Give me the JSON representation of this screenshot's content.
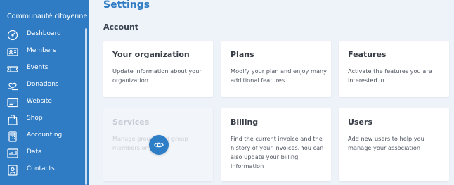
{
  "sidebar": {
    "org_name": "Communauté citoyenne",
    "items": [
      {
        "label": "Dashboard",
        "icon": "dashboard-icon"
      },
      {
        "label": "Members",
        "icon": "members-icon"
      },
      {
        "label": "Events",
        "icon": "events-icon"
      },
      {
        "label": "Donations",
        "icon": "donations-icon"
      },
      {
        "label": "Website",
        "icon": "website-icon"
      },
      {
        "label": "Shop",
        "icon": "shop-icon"
      },
      {
        "label": "Accounting",
        "icon": "accounting-icon"
      },
      {
        "label": "Data",
        "icon": "data-icon"
      },
      {
        "label": "Contacts",
        "icon": "contacts-icon"
      }
    ]
  },
  "main": {
    "title": "Settings",
    "section": "Account",
    "cards": [
      {
        "title": "Your organization",
        "desc": "Update information about your organization"
      },
      {
        "title": "Plans",
        "desc": "Modify your plan and enjoy many additional features"
      },
      {
        "title": "Features",
        "desc": "Activate the features you are interested in"
      },
      {
        "title": "Services",
        "desc": "Manage groups and group members or"
      },
      {
        "title": "Billing",
        "desc": "Find the current invoice and the history of your invoices. You can also update your billing information"
      },
      {
        "title": "Users",
        "desc": "Add new users to help you manage your association"
      }
    ]
  },
  "colors": {
    "sidebar_bg": "#2f7cc4",
    "accent": "#2f7cc4",
    "page_bg": "#eef2f9"
  },
  "overlay": {
    "icon": "eye-icon"
  }
}
